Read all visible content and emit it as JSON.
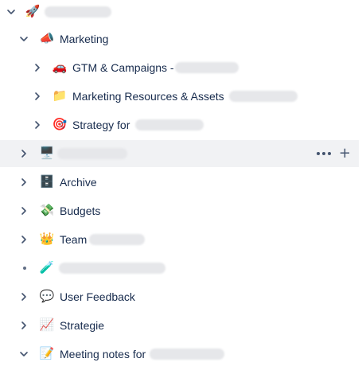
{
  "tree": {
    "root": {
      "icon": "rocket-icon",
      "emoji": "🚀",
      "label": ""
    },
    "marketing": {
      "icon": "megaphone-icon",
      "emoji": "📣",
      "label": "Marketing"
    },
    "gtm": {
      "icon": "car-icon",
      "emoji": "🚗",
      "label": "GTM & Campaigns -"
    },
    "resources": {
      "icon": "folder-icon",
      "emoji": "📁",
      "label": "Marketing Resources & Assets"
    },
    "strategy_for": {
      "icon": "target-icon",
      "emoji": "🎯",
      "label": "Strategy for"
    },
    "computer_page": {
      "icon": "desktop-icon",
      "emoji": "🖥️",
      "label": ""
    },
    "archive": {
      "icon": "cabinet-icon",
      "emoji": "🗄️",
      "label": "Archive"
    },
    "budgets": {
      "icon": "money-icon",
      "emoji": "💸",
      "label": "Budgets"
    },
    "team": {
      "icon": "crown-icon",
      "emoji": "👑",
      "label": "Team"
    },
    "test_page": {
      "icon": "test-tube-icon",
      "emoji": "🧪",
      "label": ""
    },
    "user_feedback": {
      "icon": "speech-bubble-icon",
      "emoji": "💬",
      "label": "User Feedback"
    },
    "strategie": {
      "icon": "chart-up-icon",
      "emoji": "📈",
      "label": "Strategie"
    },
    "meeting_notes": {
      "icon": "memo-icon",
      "emoji": "📝",
      "label": "Meeting notes for"
    }
  },
  "row_actions": {
    "more_icon": "more-horizontal-icon",
    "add_icon": "plus-icon"
  }
}
